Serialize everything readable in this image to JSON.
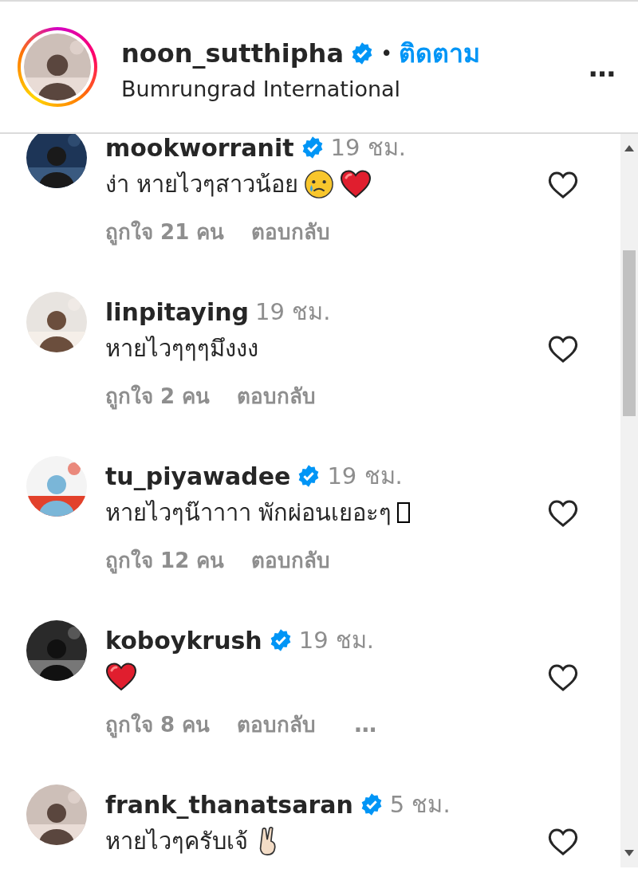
{
  "header": {
    "username": "noon_sutthipha",
    "verified": true,
    "separator": "•",
    "follow": "ติดตาม",
    "location": "Bumrungrad International",
    "more": "…"
  },
  "comments": [
    {
      "username": "mookworranit",
      "verified": true,
      "time": "19 ชม.",
      "text": "ง่า หายไวๆสาวน้อย",
      "emojis": [
        {
          "kind": "crying-face"
        },
        {
          "kind": "heart"
        }
      ],
      "likes": "ถูกใจ 21 คน",
      "reply": "ตอบกลับ",
      "liked": false
    },
    {
      "username": "linpitaying",
      "verified": false,
      "time": "19 ชม.",
      "text": "หายไวๆๆๆมึงงง",
      "likes": "ถูกใจ 2 คน",
      "reply": "ตอบกลับ",
      "liked": false
    },
    {
      "username": "tu_piyawadee",
      "verified": true,
      "time": "19 ชม.",
      "text": "หายไวๆน๊าาาา พักผ่อนเยอะๆ",
      "emojis": [
        {
          "kind": "missing-glyph"
        }
      ],
      "likes": "ถูกใจ 12 คน",
      "reply": "ตอบกลับ",
      "liked": false
    },
    {
      "username": "koboykrush",
      "verified": true,
      "time": "19 ชม.",
      "emojis": [
        {
          "kind": "heart"
        }
      ],
      "likes": "ถูกใจ 8 คน",
      "reply": "ตอบกลับ",
      "more": "…",
      "liked": false
    },
    {
      "username": "frank_thanatsaran",
      "verified": true,
      "time": "5 ชม.",
      "text": "หายไวๆครับเจ้",
      "emojis": [
        {
          "kind": "victory-hand"
        }
      ],
      "liked": false
    }
  ]
}
